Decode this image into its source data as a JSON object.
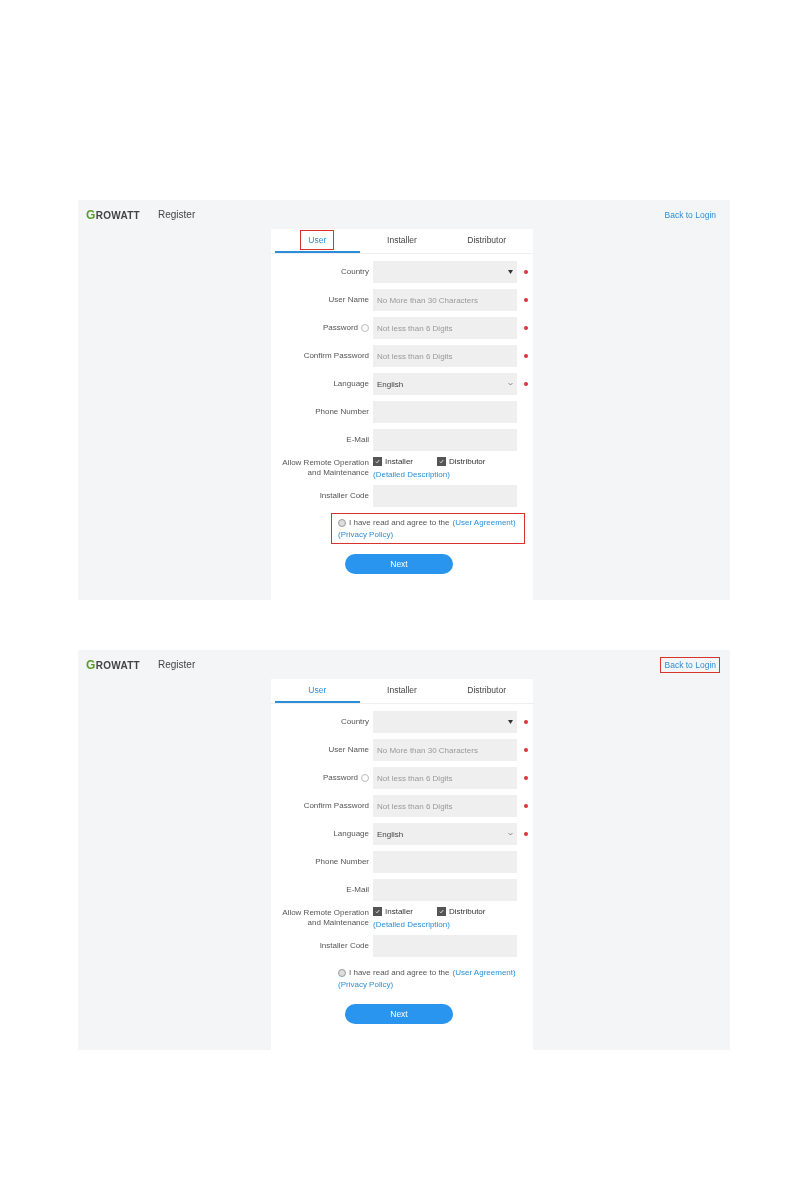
{
  "screenshots": [
    {
      "header": {
        "logo": "GROWATT",
        "title": "Register",
        "back_link": {
          "label": "Back to Login",
          "highlighted": false
        }
      },
      "tabs": [
        {
          "label": "User",
          "selected": true,
          "highlighted": true
        },
        {
          "label": "Installer",
          "selected": false,
          "highlighted": false
        },
        {
          "label": "Distributor",
          "selected": false,
          "highlighted": false
        }
      ],
      "fields": [
        {
          "kind": "select",
          "label": "Country",
          "required": true,
          "help": false
        },
        {
          "kind": "input",
          "label": "User Name",
          "placeholder": "No More than 30 Characters",
          "required": true,
          "help": false
        },
        {
          "kind": "input",
          "label": "Password",
          "placeholder": "Not less than 6 Digits",
          "required": true,
          "help": true
        },
        {
          "kind": "input",
          "label": "Confirm Password",
          "placeholder": "Not less than 6 Digits",
          "required": true,
          "help": false
        },
        {
          "kind": "dropdown",
          "label": "Language",
          "value": "English",
          "required": true,
          "help": false
        },
        {
          "kind": "input",
          "label": "Phone Number",
          "required": false,
          "help": false
        },
        {
          "kind": "input",
          "label": "E-Mail",
          "required": false,
          "help": false
        }
      ],
      "remote": {
        "label": "Allow Remote Operation and Maintenance",
        "options": [
          {
            "label": "Installer",
            "checked": true
          },
          {
            "label": "Distributor",
            "checked": true
          }
        ],
        "link": "(Detailed Description)"
      },
      "installer_code": {
        "label": "Installer Code"
      },
      "agreement": {
        "checked": false,
        "text": "I have read and agree to the",
        "links": [
          "(User Agreement)",
          "(Privacy Policy)"
        ],
        "highlighted": true
      },
      "button": "Next"
    },
    {
      "header": {
        "logo": "GROWATT",
        "title": "Register",
        "back_link": {
          "label": "Back to Login",
          "highlighted": true
        }
      },
      "tabs": [
        {
          "label": "User",
          "selected": true,
          "highlighted": false
        },
        {
          "label": "Installer",
          "selected": false,
          "highlighted": false
        },
        {
          "label": "Distributor",
          "selected": false,
          "highlighted": false
        }
      ],
      "fields": [
        {
          "kind": "select",
          "label": "Country",
          "required": true,
          "help": false
        },
        {
          "kind": "input",
          "label": "User Name",
          "placeholder": "No More than 30 Characters",
          "required": true,
          "help": false
        },
        {
          "kind": "input",
          "label": "Password",
          "placeholder": "Not less than 6 Digits",
          "required": true,
          "help": true
        },
        {
          "kind": "input",
          "label": "Confirm Password",
          "placeholder": "Not less than 6 Digits",
          "required": true,
          "help": false
        },
        {
          "kind": "dropdown",
          "label": "Language",
          "value": "English",
          "required": true,
          "help": false
        },
        {
          "kind": "input",
          "label": "Phone Number",
          "required": false,
          "help": false
        },
        {
          "kind": "input",
          "label": "E-Mail",
          "required": false,
          "help": false
        }
      ],
      "remote": {
        "label": "Allow Remote Operation and Maintenance",
        "options": [
          {
            "label": "Installer",
            "checked": true
          },
          {
            "label": "Distributor",
            "checked": true
          }
        ],
        "link": "(Detailed Description)"
      },
      "installer_code": {
        "label": "Installer Code"
      },
      "agreement": {
        "checked": false,
        "text": "I have read and agree to the",
        "links": [
          "(User Agreement)",
          "(Privacy Policy)"
        ],
        "highlighted": false
      },
      "button": "Next"
    }
  ]
}
